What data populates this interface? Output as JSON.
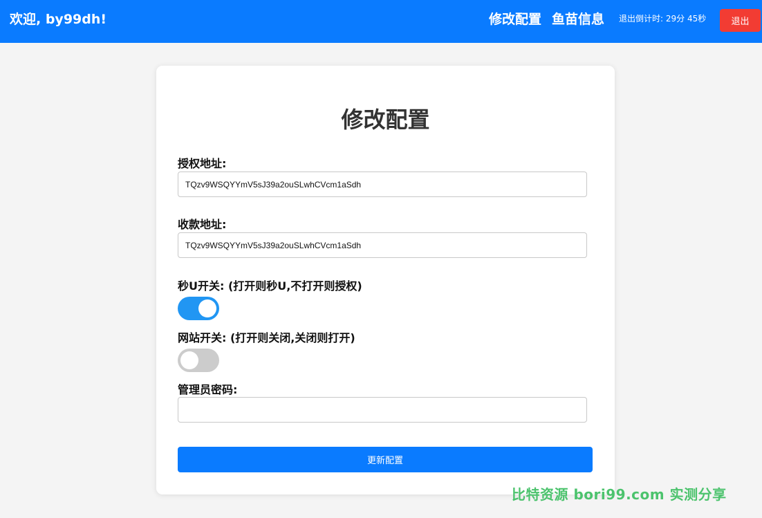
{
  "header": {
    "welcome": "欢迎, by99dh!",
    "nav": {
      "edit_config": "修改配置",
      "fish_info": "鱼苗信息"
    },
    "countdown": "退出倒计时:  29分 45秒",
    "logout_label": "退出"
  },
  "form": {
    "title": "修改配置",
    "auth_address": {
      "label": "授权地址:",
      "value": "TQzv9WSQYYmV5sJ39a2ouSLwhCVcm1aSdh"
    },
    "payee_address": {
      "label": "收款地址:",
      "value": "TQzv9WSQYYmV5sJ39a2ouSLwhCVcm1aSdh"
    },
    "instant_u_switch": {
      "label": "秒U开关:  (打开则秒U,不打开则授权)",
      "on": true
    },
    "site_switch": {
      "label": "网站开关:  (打开则关闭,关闭则打开)",
      "on": false
    },
    "admin_password": {
      "label": "管理员密码:",
      "value": ""
    },
    "submit_label": "更新配置"
  },
  "watermark": "比特资源  bori99.com  实测分享",
  "colors": {
    "primary": "#0a7bff",
    "danger": "#f23c33",
    "toggle_on": "#2196f3",
    "toggle_off": "#cccccc",
    "watermark": "#4cc36d"
  }
}
